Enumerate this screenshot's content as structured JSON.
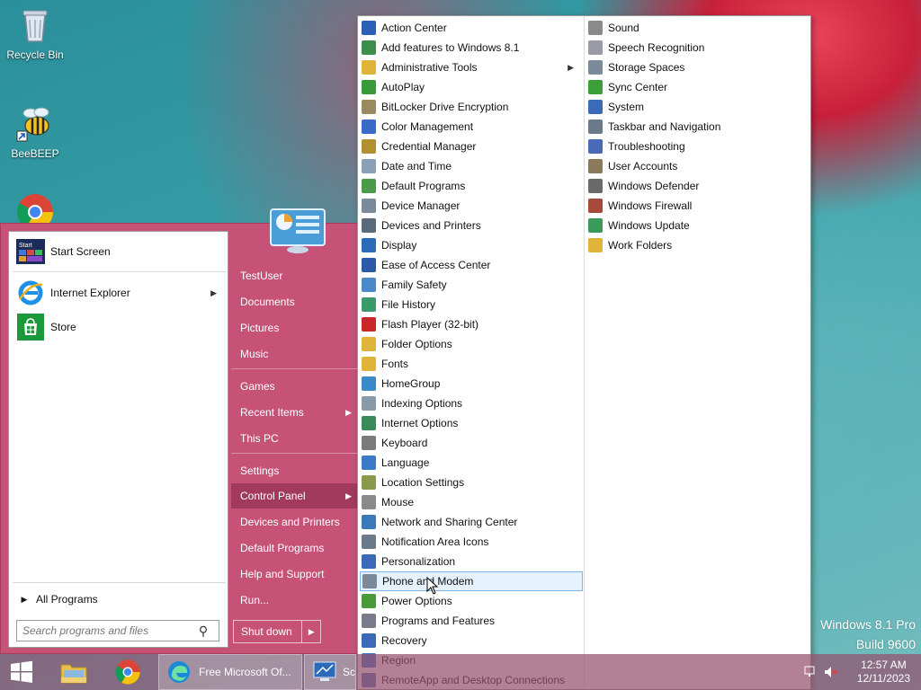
{
  "desktop": {
    "icons": [
      {
        "label": "Recycle Bin"
      },
      {
        "label": "BeeBEEP"
      }
    ],
    "watermark": {
      "line1": "Windows 8.1 Pro",
      "line2": "Build 9600"
    }
  },
  "start_menu": {
    "pinned": [
      {
        "label": "Start Screen",
        "icon": "start-screen-icon"
      },
      {
        "label": "Internet Explorer",
        "icon": "internet-explorer-icon",
        "has_submenu": true
      },
      {
        "label": "Store",
        "icon": "store-icon"
      }
    ],
    "all_programs": "All Programs",
    "search_placeholder": "Search programs and files",
    "right_items": [
      {
        "label": "TestUser"
      },
      {
        "label": "Documents"
      },
      {
        "label": "Pictures"
      },
      {
        "label": "Music"
      },
      {
        "label": "Games"
      },
      {
        "label": "Recent Items",
        "has_submenu": true
      },
      {
        "label": "This PC"
      },
      {
        "label": "Settings"
      },
      {
        "label": "Control Panel",
        "has_submenu": true,
        "selected": true
      },
      {
        "label": "Devices and Printers"
      },
      {
        "label": "Default Programs"
      },
      {
        "label": "Help and Support"
      },
      {
        "label": "Run..."
      }
    ],
    "shutdown_label": "Shut down"
  },
  "control_panel": {
    "column1": [
      {
        "label": "Action Center",
        "color": "#2b5fb8"
      },
      {
        "label": "Add features to Windows 8.1",
        "color": "#3a8f4a"
      },
      {
        "label": "Administrative Tools",
        "color": "#e0b43a",
        "has_submenu": true
      },
      {
        "label": "AutoPlay",
        "color": "#3a9a3a"
      },
      {
        "label": "BitLocker Drive Encryption",
        "color": "#9a8a60"
      },
      {
        "label": "Color Management",
        "color": "#3a6ac8"
      },
      {
        "label": "Credential Manager",
        "color": "#b09030"
      },
      {
        "label": "Date and Time",
        "color": "#8aa0b8"
      },
      {
        "label": "Default Programs",
        "color": "#4a9a4a"
      },
      {
        "label": "Device Manager",
        "color": "#7a8a9a"
      },
      {
        "label": "Devices and Printers",
        "color": "#5a6a7a"
      },
      {
        "label": "Display",
        "color": "#2a6ab8"
      },
      {
        "label": "Ease of Access Center",
        "color": "#2a5aa8"
      },
      {
        "label": "Family Safety",
        "color": "#4a8ac8"
      },
      {
        "label": "File History",
        "color": "#3a9a6a"
      },
      {
        "label": "Flash Player (32-bit)",
        "color": "#c8282a"
      },
      {
        "label": "Folder Options",
        "color": "#e0b43a"
      },
      {
        "label": "Fonts",
        "color": "#e0b43a"
      },
      {
        "label": "HomeGroup",
        "color": "#3a8ac8"
      },
      {
        "label": "Indexing Options",
        "color": "#8a9aa8"
      },
      {
        "label": "Internet Options",
        "color": "#3a8a5a"
      },
      {
        "label": "Keyboard",
        "color": "#7a7a7a"
      },
      {
        "label": "Language",
        "color": "#3a7ac8"
      },
      {
        "label": "Location Settings",
        "color": "#8a9a4a"
      },
      {
        "label": "Mouse",
        "color": "#8a8a8a"
      },
      {
        "label": "Network and Sharing Center",
        "color": "#3a7ab8"
      },
      {
        "label": "Notification Area Icons",
        "color": "#6a7a8a"
      },
      {
        "label": "Personalization",
        "color": "#3a6ab8"
      },
      {
        "label": "Phone and Modem",
        "color": "#7a8a9a",
        "highlighted": true
      },
      {
        "label": "Power Options",
        "color": "#4a9a3a"
      },
      {
        "label": "Programs and Features",
        "color": "#7a7a8a"
      },
      {
        "label": "Recovery",
        "color": "#3a6ab8"
      },
      {
        "label": "Region",
        "color": "#3a7ac8"
      },
      {
        "label": "RemoteApp and Desktop Connections",
        "color": "#4a7ab8"
      }
    ],
    "column2": [
      {
        "label": "Sound",
        "color": "#8a8a8a"
      },
      {
        "label": "Speech Recognition",
        "color": "#9a9aa8"
      },
      {
        "label": "Storage Spaces",
        "color": "#7a8a9a"
      },
      {
        "label": "Sync Center",
        "color": "#3aa03a"
      },
      {
        "label": "System",
        "color": "#3a6ab8"
      },
      {
        "label": "Taskbar and Navigation",
        "color": "#6a7a8a"
      },
      {
        "label": "Troubleshooting",
        "color": "#4a6ab8"
      },
      {
        "label": "User Accounts",
        "color": "#8a7a5a"
      },
      {
        "label": "Windows Defender",
        "color": "#6a6a6a"
      },
      {
        "label": "Windows Firewall",
        "color": "#a84a3a"
      },
      {
        "label": "Windows Update",
        "color": "#3a9a5a"
      },
      {
        "label": "Work Folders",
        "color": "#e0b43a"
      }
    ]
  },
  "taskbar": {
    "edge_title": "Free Microsoft Of...",
    "sc_title": "Sc",
    "clock_time": "12:57 AM",
    "clock_date": "12/11/2023"
  }
}
